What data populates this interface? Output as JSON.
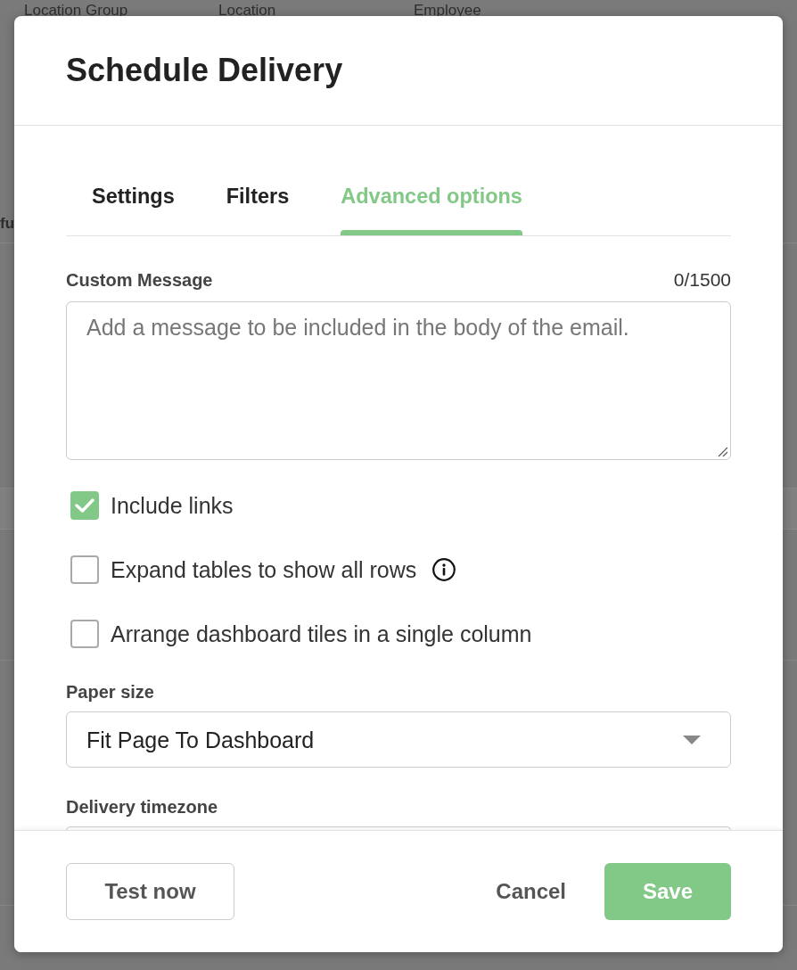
{
  "background": {
    "column_headers": [
      "Location Group",
      "Location",
      "Employee"
    ],
    "cut_text": "fu"
  },
  "dialog": {
    "title": "Schedule Delivery",
    "tabs": [
      {
        "label": "Settings",
        "selected": false
      },
      {
        "label": "Filters",
        "selected": false
      },
      {
        "label": "Advanced options",
        "selected": true
      }
    ],
    "custom_message": {
      "label": "Custom Message",
      "counter": "0/1500",
      "placeholder": "Add a message to be included in the body of the email."
    },
    "options": [
      {
        "label": "Include links",
        "checked": true,
        "info": false
      },
      {
        "label": "Expand tables to show all rows",
        "checked": false,
        "info": true
      },
      {
        "label": "Arrange dashboard tiles in a single column",
        "checked": false,
        "info": false
      }
    ],
    "paper_size": {
      "label": "Paper size",
      "value": "Fit Page To Dashboard"
    },
    "delivery_timezone": {
      "label": "Delivery timezone"
    },
    "footer": {
      "test_button": "Test now",
      "cancel_button": "Cancel",
      "save_button": "Save"
    }
  }
}
